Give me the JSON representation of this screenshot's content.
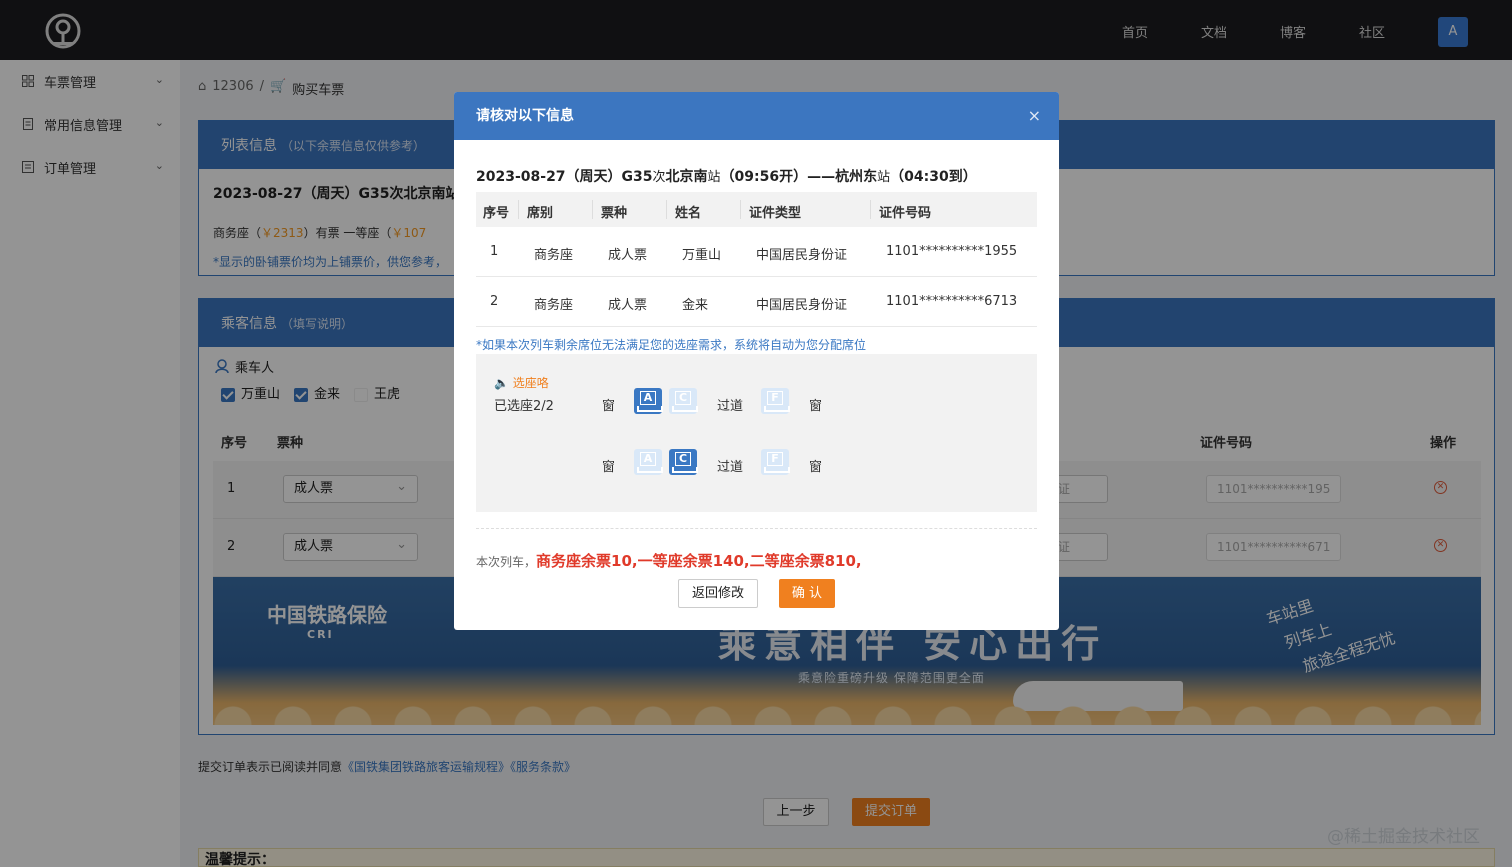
{
  "topnav": {
    "items": [
      "首页",
      "文档",
      "博客",
      "社区"
    ],
    "avatar": "A"
  },
  "sidebar": {
    "items": [
      {
        "label": "车票管理",
        "icon": "grid-icon"
      },
      {
        "label": "常用信息管理",
        "icon": "document-icon"
      },
      {
        "label": "订单管理",
        "icon": "list-icon"
      }
    ]
  },
  "breadcrumb": {
    "home": "12306",
    "separator": "/",
    "current": "购买车票"
  },
  "list_panel": {
    "title": "列表信息",
    "subtitle": "（以下余票信息仅供参考）",
    "date_line": "2023-08-27（周天）G35次北京南站",
    "seat_line_a": "商务座（",
    "seat_price_a": "￥2313",
    "seat_line_b": "）有票  一等座（",
    "seat_price_b": "￥107",
    "note": "*显示的卧铺票价均为上铺票价，供您参考，"
  },
  "passenger_panel": {
    "title": "乘客信息",
    "subtitle": "（填写说明）",
    "passenger_label": "乘车人",
    "passengers": [
      {
        "name": "万重山",
        "checked": true
      },
      {
        "name": "金来",
        "checked": true
      },
      {
        "name": "王虎",
        "checked": false
      }
    ],
    "columns": {
      "num": "序号",
      "ticket_type": "票种",
      "id_number": "证件号码",
      "action": "操作"
    },
    "rows": [
      {
        "num": "1",
        "ticket_type": "成人票",
        "id_type_partial": "证",
        "id": "1101**********195"
      },
      {
        "num": "2",
        "ticket_type": "成人票",
        "id_type_partial": "证",
        "id": "1101**********671"
      }
    ]
  },
  "banner": {
    "logo_text": "中国铁路保险",
    "logo_sub": "CRI",
    "headline": "乘意相伴 安心出行",
    "subline": "乘意险重磅升级 保障范围更全面",
    "handwriting": [
      "车站里",
      "列车上",
      "旅途全程无忧"
    ]
  },
  "agreement": {
    "prefix": "提交订单表示已阅读并同意",
    "link1": "《国铁集团铁路旅客运输规程》",
    "link2": "《服务条款》"
  },
  "buttons": {
    "prev": "上一步",
    "submit": "提交订单"
  },
  "warm_tip": "温馨提示：",
  "watermark": "@稀土掘金技术社区",
  "modal": {
    "title": "请核对以下信息",
    "close": "×",
    "train_date": "2023-08-27（周天）G35",
    "train_ci": "次",
    "train_from": "北京南",
    "train_zhan1": "站",
    "train_dep": "（09:56开）——杭州东",
    "train_zhan2": "站",
    "train_arr": "（04:30到）",
    "columns": [
      "序号",
      "席别",
      "票种",
      "姓名",
      "证件类型",
      "证件号码"
    ],
    "rows": [
      [
        "1",
        "商务座",
        "成人票",
        "万重山",
        "中国居民身份证",
        "1101**********1955"
      ],
      [
        "2",
        "商务座",
        "成人票",
        "金来",
        "中国居民身份证",
        "1101**********6713"
      ]
    ],
    "hint": "*如果本次列车剩余席位无法满足您的选座需求，系统将自动为您分配席位",
    "seat_title": "选座咯",
    "seat_count": "已选座2/2",
    "window": "窗",
    "aisle": "过道",
    "seat_rows": [
      {
        "A": true,
        "C": false,
        "F": false
      },
      {
        "A": false,
        "C": true,
        "F": false
      }
    ],
    "seat_letters": [
      "A",
      "C",
      "F"
    ],
    "remain_prefix": "本次列车，",
    "remain_text": "商务座余票10,一等座余票140,二等座余票810,",
    "back": "返回修改",
    "confirm": "确 认"
  }
}
